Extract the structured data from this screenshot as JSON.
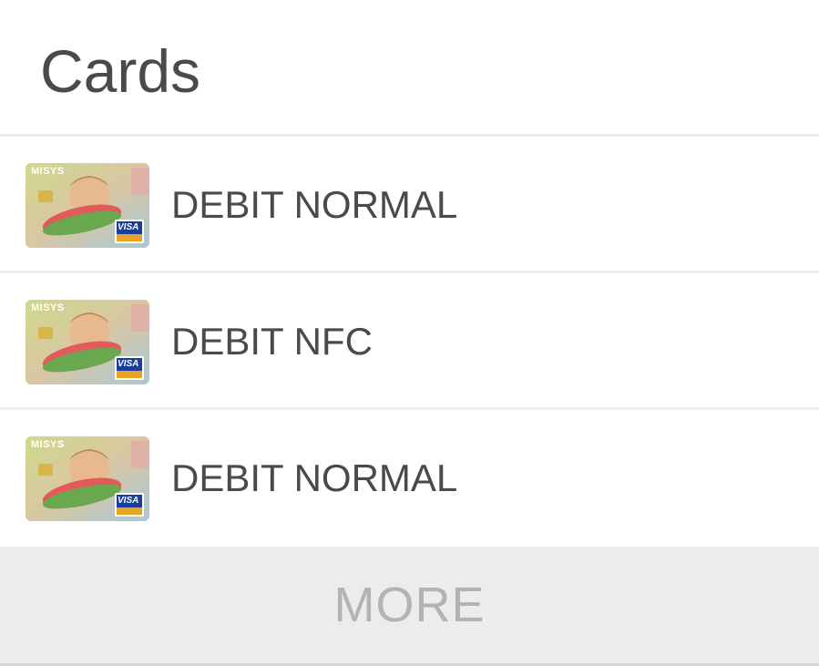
{
  "header": {
    "title": "Cards"
  },
  "cards": [
    {
      "label": "DEBIT NORMAL",
      "brand_text": "MISYS",
      "network_icon": "visa-logo-icon"
    },
    {
      "label": "DEBIT NFC",
      "brand_text": "MISYS",
      "network_icon": "visa-logo-icon"
    },
    {
      "label": "DEBIT NORMAL",
      "brand_text": "MISYS",
      "network_icon": "visa-logo-icon"
    }
  ],
  "footer": {
    "more_label": "MORE"
  },
  "colors": {
    "text_primary": "#4a4a4a",
    "divider": "#ececec",
    "more_background": "#ececec",
    "more_text": "#b3b3b3",
    "visa_blue": "#1a3e9a"
  }
}
